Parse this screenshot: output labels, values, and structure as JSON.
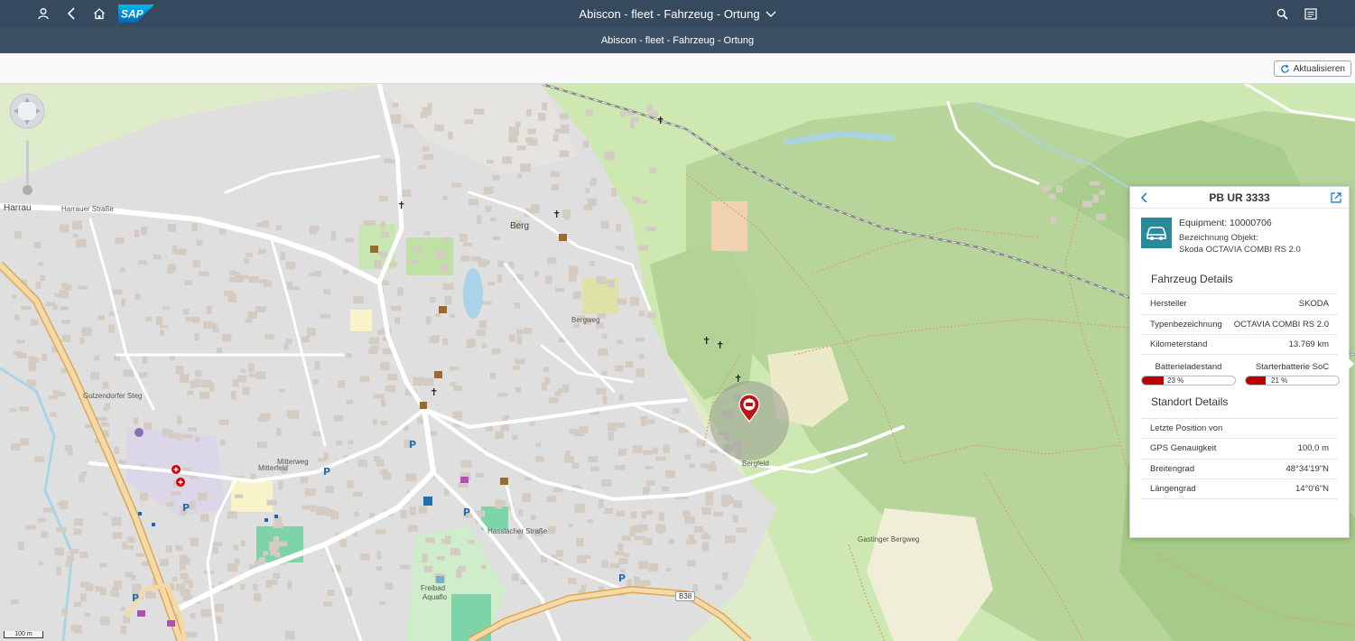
{
  "shell": {
    "title": "Abiscon - fleet - Fahrzeug - Ortung",
    "logo_text": "SAP",
    "icons": [
      "user-icon",
      "back-icon",
      "home-icon",
      "search-icon",
      "notifications-icon"
    ]
  },
  "subheader": {
    "title": "Abiscon - fleet - Fahrzeug - Ortung"
  },
  "toolbar": {
    "refresh_label": "Aktualisieren",
    "refresh_icon": "refresh-icon"
  },
  "map": {
    "labels": {
      "harrau": "Harrau",
      "harrauer_strasse": "Harrauer Straße",
      "berg": "Berg",
      "mitterfeld": "Mitterfeld",
      "bergfeld": "Bergfeld",
      "freibad": "Freibad",
      "aquaflo": "Aquaflo",
      "gutzendorfer_steg": "Gutzendorfer Steg",
      "hasslacher_strasse": "Hasslacher Straße",
      "bergweg": "Bergweg",
      "mitterweg": "Mitterweg",
      "gastinger_bergweg": "Gastinger Bergweg"
    },
    "road_badge": "B38",
    "scale": "100 m",
    "accuracy_m": 100.0,
    "colors": {
      "forest": "#b7d59b",
      "meadow": "#cde8b0",
      "residential": "#e0dfdf",
      "building": "#d4ccc3",
      "road": "#ffffff",
      "major_road": "#f6d9a8",
      "marker": "#c0101a",
      "accuracy_circle": "#8a8a8a"
    }
  },
  "panel": {
    "title": "PB UR 3333",
    "back_icon": "back-icon",
    "external_icon": "external-link-icon",
    "equipment": "Equipment: 10000706",
    "description_label": "Bezeichnung Objekt:",
    "description_value": "Skoda OCTAVIA COMBI RS 2.0",
    "vehicle_section": "Fahrzeug Details",
    "vehicle_rows": [
      {
        "label": "Hersteller",
        "value": "SKODA"
      },
      {
        "label": "Typenbezeichnung",
        "value": "OCTAVIA COMBI RS 2.0"
      },
      {
        "label": "Kilometerstand",
        "value": "13.769 km"
      }
    ],
    "battery": {
      "label": "Batterieladestand",
      "text": "23 %",
      "percent": 23
    },
    "starter": {
      "label": "Starterbatterie SoC",
      "text": "21 %",
      "percent": 21
    },
    "location_section": "Standort Details",
    "location_rows": [
      {
        "label": "Letzte Position von",
        "value": ""
      },
      {
        "label": "GPS Genauigkeit",
        "value": "100,0 m"
      },
      {
        "label": "Breitengrad",
        "value": "48°34'19\"N"
      },
      {
        "label": "Längengrad",
        "value": "14°0'6\"N"
      }
    ]
  }
}
